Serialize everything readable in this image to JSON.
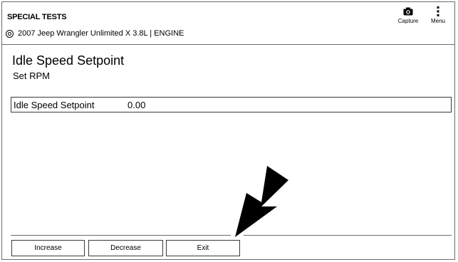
{
  "header": {
    "title": "SPECIAL TESTS",
    "vehicle": "2007 Jeep Wrangler Unlimited X 3.8L | ENGINE",
    "capture_label": "Capture",
    "menu_label": "Menu"
  },
  "test": {
    "title": "Idle Speed Setpoint",
    "subtitle": "Set RPM",
    "readout_label": "Idle Speed Setpoint",
    "readout_value": "0.00"
  },
  "buttons": {
    "increase": "Increase",
    "decrease": "Decrease",
    "exit": "Exit"
  },
  "icons": {
    "capture": "camera-icon",
    "menu": "vertical-ellipsis-icon",
    "vehicle": "target-circle-icon",
    "annotation": "arrow-pointer"
  }
}
